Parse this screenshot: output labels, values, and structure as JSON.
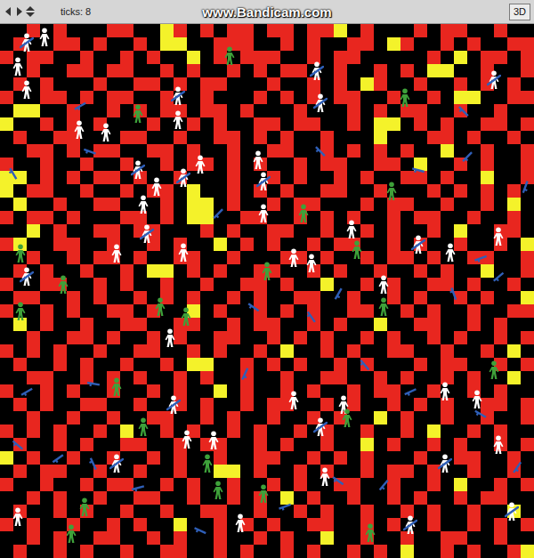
{
  "toolbar": {
    "ticks": "ticks: 8",
    "watermark": "www.Bandicam.com",
    "button": "3D"
  },
  "world": {
    "palette": {
      ".": "#000000",
      "r": "#e8261f",
      "y": "#f4f22a"
    },
    "patches": [
      "..r.r...rr..yr.r.rr.rr.rry.r...r.rr..r..",
      ".r..rr.r..r.yy..rrr..r.r..rr.yr..r.r..rr",
      "r.rr..r..r.r..y.r.rrr..r.rr.....r.y.rr.r",
      "..r..rr.rr..r.r..r.r.rr..r..r.r.yy..r..r",
      ".r.r...r..rr.r.rr...r..r.r.yr..r..r.r.r.",
      "r..rr.r.rr..r..r...r.r.r.rr..r..r.yy..rr",
      ".yy..r..r.r.rr.rr.r...r...r.r.rr..r..r..",
      "y..r.r.r...r..r.r..rr.rr..r.yy.r.r..rr.r",
      ".r..rr...rr..r..rr.r.r..r...y...rr.r..r.",
      "..rr.r.rr..rr.r..r..rr..r.r.r.r..y..r..r",
      "r..r..r..r..r.rr.r.r..r.rr..rr.y..r.r..r",
      "yy.r.r.rr.r..r...r..r.r..r.r..rr.r..y..r",
      "y.rr..r..r.rr.y..r.r.r..rr..r...r.r.r.r.",
      ".y..r..rr...r.yy.r..r.rr...r.rr..r..r.y.",
      "r.rr.r...rr.r.yy..rr..r.r.r..r.rr..r..r.",
      "..y.r..rr.rr...r.r..rr..r..r.r..r.y..rr.",
      "ry..rr..r..r.r..y.r.r..r.rr..r.r..r..r.y",
      "..r..r.rr.r..rr..r...rr.r..r.rr.r..rr..r",
      ".r.r..r..r.yy.r.r..rr..r.r..r..r.r..y..r",
      "r..rr..r.r..r..r..rr.r..y..r.r..rr.r..r.",
      ".rr..r.r..r.r.r..r.r..rr..r..r.r..r.r..y",
      "r..r.r..rr.r..y.r..r.r.r..rr..r.r..r..rr",
      ".y.r..r..rr..rr..r.rr..r.r..y..rr..r.r..",
      "..r..rr.r..r.r..rr..r.r.r..r.r..r.r..r.r",
      "r.r.r..r..rr..r.r..r.y..r.r..rr..r..r.y.",
      ".r..r.r..r..r.yy..r.r.r..r.r...r.rr..r.r",
      "..rr..r.r.r..r.r..r..r..rr..r.r..r.r..y.",
      "r..r.r..r..r.r..y.r..r.r..r.rr..r..r.r..",
      ".r.r..rr..r..r.r..r.rr..r.r..r.r.r..rr.r",
      "..r..r..r..rr..r.r..r..r.r..y.r..r..r..r",
      "r.r.r..r.y..r.r..r.r..r.r..r..r.y..r.r..",
      ".r..r.r..rr..r.rr..r.r..r..y.r..r.r..r.r",
      "y.r..r..r..r.r..r..rr..r.r.r...r..rr..r.",
      ".r.rr..r..r..r..yy.r..r.r..r.rr.r..r..r.",
      "r..r..r.rr..r.r..r..r.r..rr..r..r.y..r.r",
      "..r.r..r..rr..r..r.r.y.r..r..r.r..r.rr..",
      ".r..r.r..r..r..rr..r..r.r..r..r.r..r..y.",
      "r.r..r..r.r..y..r.r.r..rr..r.r..r..r.r.r",
      "..r.r..rr..r.r..r..r.r..y..r..r..rr..r..",
      ".r..r.r..r..rr..r.r..r.r..r.r.y..r.r..ry"
    ]
  },
  "agents": [
    {
      "kind": "civilian",
      "x": 1.3,
      "y": 3.2
    },
    {
      "kind": "civilian",
      "x": 2,
      "y": 4.9
    },
    {
      "kind": "civilian",
      "x": 5.9,
      "y": 7.9
    },
    {
      "kind": "civilian",
      "x": 7.9,
      "y": 8.1
    },
    {
      "kind": "civilian",
      "x": 13.3,
      "y": 7.2
    },
    {
      "kind": "civilian",
      "x": 15,
      "y": 10.5
    },
    {
      "kind": "civilian",
      "x": 19.3,
      "y": 10.2
    },
    {
      "kind": "civilian",
      "x": 10.7,
      "y": 13.5
    },
    {
      "kind": "civilian",
      "x": 13.7,
      "y": 17.1
    },
    {
      "kind": "civilian",
      "x": 8.7,
      "y": 17.2
    },
    {
      "kind": "civilian",
      "x": 19.7,
      "y": 14.2
    },
    {
      "kind": "civilian",
      "x": 22,
      "y": 17.5
    },
    {
      "kind": "civilian",
      "x": 23.3,
      "y": 17.9
    },
    {
      "kind": "civilian",
      "x": 26.3,
      "y": 15.4
    },
    {
      "kind": "civilian",
      "x": 33.7,
      "y": 17.1
    },
    {
      "kind": "civilian",
      "x": 37.3,
      "y": 15.9
    },
    {
      "kind": "civilian",
      "x": 28.7,
      "y": 19.5
    },
    {
      "kind": "civilian",
      "x": 12.7,
      "y": 23.5
    },
    {
      "kind": "civilian",
      "x": 22,
      "y": 28.2
    },
    {
      "kind": "civilian",
      "x": 25.7,
      "y": 28.5
    },
    {
      "kind": "civilian",
      "x": 35.7,
      "y": 28.1
    },
    {
      "kind": "civilian",
      "x": 14,
      "y": 31.1
    },
    {
      "kind": "civilian",
      "x": 16,
      "y": 31.2
    },
    {
      "kind": "civilian",
      "x": 18,
      "y": 37.4
    },
    {
      "kind": "civilian",
      "x": 1.3,
      "y": 36.9
    },
    {
      "kind": "civilian",
      "x": 37.3,
      "y": 31.5
    },
    {
      "kind": "civilian",
      "x": 24.3,
      "y": 33.9
    },
    {
      "kind": "civilian",
      "x": 3.3,
      "y": 1
    },
    {
      "kind": "civilian",
      "x": 11.7,
      "y": 12.2
    },
    {
      "kind": "civilian",
      "x": 33.3,
      "y": 27.5
    },
    {
      "kind": "infected",
      "x": 17.2,
      "y": 2.4
    },
    {
      "kind": "infected",
      "x": 10.3,
      "y": 6.7
    },
    {
      "kind": "infected",
      "x": 30.3,
      "y": 5.5
    },
    {
      "kind": "infected",
      "x": 1.5,
      "y": 17.2
    },
    {
      "kind": "infected",
      "x": 4.7,
      "y": 19.5
    },
    {
      "kind": "infected",
      "x": 12,
      "y": 21.2
    },
    {
      "kind": "infected",
      "x": 13.9,
      "y": 21.9
    },
    {
      "kind": "infected",
      "x": 22.7,
      "y": 14.2
    },
    {
      "kind": "infected",
      "x": 20,
      "y": 18.5
    },
    {
      "kind": "infected",
      "x": 26.7,
      "y": 16.9
    },
    {
      "kind": "infected",
      "x": 28.7,
      "y": 21.2
    },
    {
      "kind": "infected",
      "x": 8.7,
      "y": 27.2
    },
    {
      "kind": "infected",
      "x": 10.7,
      "y": 30.2
    },
    {
      "kind": "infected",
      "x": 15.5,
      "y": 32.9
    },
    {
      "kind": "infected",
      "x": 16.3,
      "y": 34.9
    },
    {
      "kind": "infected",
      "x": 6.3,
      "y": 36.2
    },
    {
      "kind": "infected",
      "x": 5.3,
      "y": 38.2
    },
    {
      "kind": "infected",
      "x": 27.7,
      "y": 38.1
    },
    {
      "kind": "infected",
      "x": 19.7,
      "y": 35.2
    },
    {
      "kind": "infected",
      "x": 26,
      "y": 29.5
    },
    {
      "kind": "infected",
      "x": 37,
      "y": 25.9
    },
    {
      "kind": "infected",
      "x": 29.3,
      "y": 12.5
    },
    {
      "kind": "infected",
      "x": 1.5,
      "y": 21.5
    },
    {
      "kind": "armed",
      "x": 2,
      "y": 1.4
    },
    {
      "kind": "armed",
      "x": 23.7,
      "y": 3.5
    },
    {
      "kind": "armed",
      "x": 24,
      "y": 5.9
    },
    {
      "kind": "armed",
      "x": 13.3,
      "y": 5.4
    },
    {
      "kind": "armed",
      "x": 10.3,
      "y": 10.9
    },
    {
      "kind": "armed",
      "x": 13.7,
      "y": 11.5
    },
    {
      "kind": "armed",
      "x": 19.7,
      "y": 11.8
    },
    {
      "kind": "armed",
      "x": 31.3,
      "y": 16.5
    },
    {
      "kind": "armed",
      "x": 2,
      "y": 18.9
    },
    {
      "kind": "armed",
      "x": 13,
      "y": 28.5
    },
    {
      "kind": "armed",
      "x": 8.7,
      "y": 32.9
    },
    {
      "kind": "armed",
      "x": 33.3,
      "y": 32.9
    },
    {
      "kind": "armed",
      "x": 30.7,
      "y": 37.5
    },
    {
      "kind": "armed",
      "x": 38.3,
      "y": 36.5
    },
    {
      "kind": "armed",
      "x": 37,
      "y": 4.2
    },
    {
      "kind": "armed",
      "x": 24,
      "y": 30.2
    },
    {
      "kind": "armed",
      "x": 11,
      "y": 15.7
    },
    {
      "kind": "gun",
      "x": 1,
      "y": 11.2,
      "heading": 60
    },
    {
      "kind": "gun",
      "x": 6,
      "y": 6.1,
      "heading": -30
    },
    {
      "kind": "gun",
      "x": 6.7,
      "y": 9.5,
      "heading": 20
    },
    {
      "kind": "gun",
      "x": 16.3,
      "y": 14.2,
      "heading": -45
    },
    {
      "kind": "gun",
      "x": 19,
      "y": 21.2,
      "heading": 35
    },
    {
      "kind": "gun",
      "x": 25.3,
      "y": 20.2,
      "heading": -60
    },
    {
      "kind": "gun",
      "x": 34.7,
      "y": 6.5,
      "heading": 45
    },
    {
      "kind": "gun",
      "x": 36,
      "y": 17.5,
      "heading": -20
    },
    {
      "kind": "gun",
      "x": 34,
      "y": 20.2,
      "heading": 70
    },
    {
      "kind": "gun",
      "x": 37.3,
      "y": 18.9,
      "heading": -40
    },
    {
      "kind": "gun",
      "x": 31.3,
      "y": 10.9,
      "heading": 15
    },
    {
      "kind": "gun",
      "x": 39.3,
      "y": 12.2,
      "heading": -70
    },
    {
      "kind": "gun",
      "x": 27.3,
      "y": 25.5,
      "heading": 50
    },
    {
      "kind": "gun",
      "x": 30.7,
      "y": 27.5,
      "heading": -25
    },
    {
      "kind": "gun",
      "x": 36,
      "y": 29.2,
      "heading": 30
    },
    {
      "kind": "gun",
      "x": 38.7,
      "y": 33.2,
      "heading": -55
    },
    {
      "kind": "gun",
      "x": 1.3,
      "y": 31.5,
      "heading": 40
    },
    {
      "kind": "gun",
      "x": 4.3,
      "y": 32.5,
      "heading": -35
    },
    {
      "kind": "gun",
      "x": 7,
      "y": 32.9,
      "heading": 65
    },
    {
      "kind": "gun",
      "x": 10.3,
      "y": 34.7,
      "heading": -15
    },
    {
      "kind": "gun",
      "x": 15,
      "y": 37.9,
      "heading": 25
    },
    {
      "kind": "gun",
      "x": 28.7,
      "y": 34.5,
      "heading": -50
    },
    {
      "kind": "gun",
      "x": 23.3,
      "y": 21.9,
      "heading": 55
    },
    {
      "kind": "gun",
      "x": 18.3,
      "y": 26.2,
      "heading": -65
    },
    {
      "kind": "gun",
      "x": 7,
      "y": 26.9,
      "heading": 10
    },
    {
      "kind": "gun",
      "x": 2,
      "y": 27.5,
      "heading": -30
    },
    {
      "kind": "gun",
      "x": 24,
      "y": 9.5,
      "heading": 45
    },
    {
      "kind": "gun",
      "x": 35,
      "y": 9.9,
      "heading": -45
    },
    {
      "kind": "gun",
      "x": 25.3,
      "y": 34.2,
      "heading": 35
    },
    {
      "kind": "gun",
      "x": 21.3,
      "y": 36.1,
      "heading": -20
    }
  ]
}
